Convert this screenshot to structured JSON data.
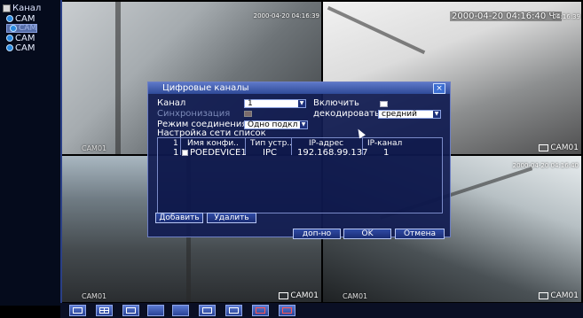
{
  "sidebar": {
    "title": "Канал",
    "items": [
      {
        "label": "CAM",
        "selected": false
      },
      {
        "label": "CAM",
        "selected": true
      },
      {
        "label": "CAM",
        "selected": false
      },
      {
        "label": "CAM",
        "selected": false
      }
    ]
  },
  "tiles": {
    "t1": {
      "timestamp": "2000-04-20 04:16:39",
      "camera": "CAM01"
    },
    "t2": {
      "timestamp": "2000-04-20 04:16:40 Чт",
      "timestamp_small": "04:16:39",
      "camera": "CAM01"
    },
    "t3": {
      "camera": "CAM01",
      "camera_right": "CAM01"
    },
    "t4": {
      "timestamp": "2000-04-20 04:16:40",
      "camera": "CAM01",
      "camera_right": "CAM01"
    }
  },
  "dialog": {
    "title": "Цифровые каналы",
    "close": "×",
    "channel_label": "Канал",
    "channel_value": "1",
    "enable_label": "Включить",
    "sync_label": "Синхронизация",
    "decode_label": "декодировать",
    "decode_value": "средний",
    "conn_mode_label": "Режим соединения",
    "conn_mode_value": "Одно подкл",
    "net_list_label": "Настройка сети список",
    "table": {
      "headers": [
        "1",
        "Имя конфи..",
        "Тип устр..",
        "IP-адрес",
        "IP-канал"
      ],
      "rows": [
        [
          "1",
          "POEDEVICE1",
          "IPC",
          "192.168.99.137",
          "1"
        ]
      ]
    },
    "add_button": "Добавить",
    "delete_button": "Удалить",
    "extra_button": "доп-но",
    "ok_button": "OK",
    "cancel_button": "Отмена"
  },
  "colors": {
    "dialog_bg": "#111c52",
    "accent": "#3c6ed2"
  }
}
